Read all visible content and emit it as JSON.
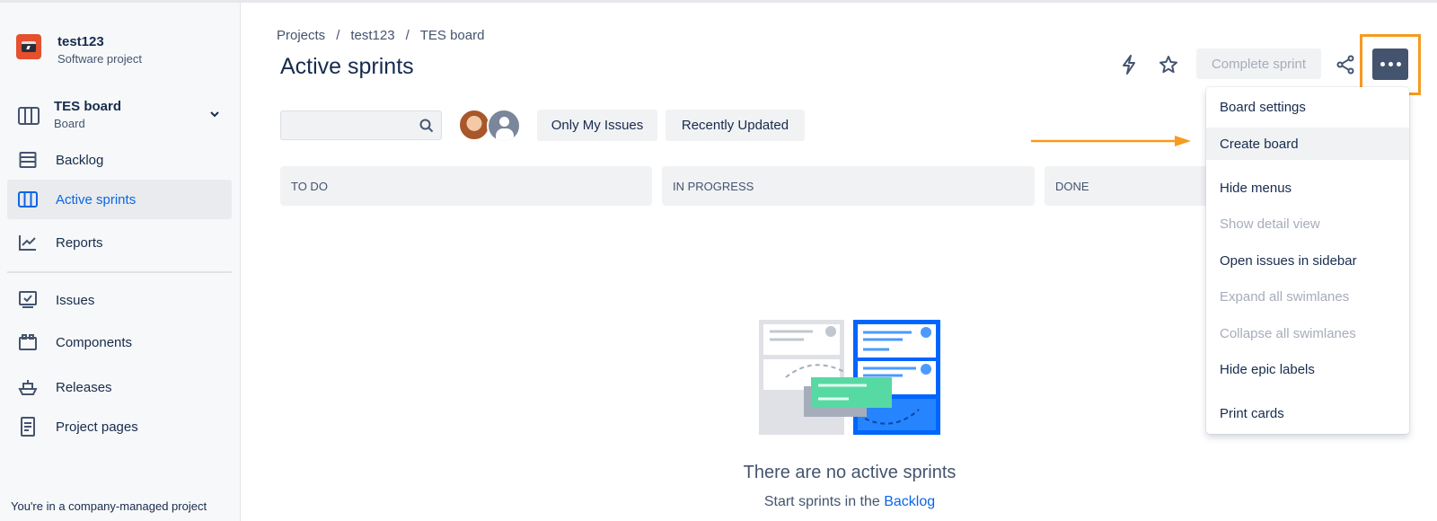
{
  "project": {
    "name": "test123",
    "type": "Software project"
  },
  "board_selector": {
    "name": "TES board",
    "subtitle": "Board"
  },
  "nav": {
    "backlog": "Backlog",
    "active_sprints": "Active sprints",
    "reports": "Reports",
    "issues": "Issues",
    "components": "Components",
    "releases": "Releases",
    "project_pages": "Project pages"
  },
  "sidebar_footer": "You're in a company-managed project",
  "breadcrumb": {
    "item1": "Projects",
    "sep": "/",
    "item2": "test123",
    "item3": "TES board"
  },
  "page_title": "Active sprints",
  "toolbar": {
    "complete_sprint": "Complete sprint"
  },
  "filters": {
    "only_my_issues": "Only My Issues",
    "recently_updated": "Recently Updated"
  },
  "columns": {
    "todo": "TO DO",
    "in_progress": "IN PROGRESS",
    "done": "DONE"
  },
  "empty_state": {
    "title": "There are no active sprints",
    "subtitle_prefix": "Start sprints in the",
    "subtitle_link": "Backlog"
  },
  "menu": {
    "board_settings": "Board settings",
    "create_board": "Create board",
    "hide_menus": "Hide menus",
    "show_detail_view": "Show detail view",
    "open_issues_in_sidebar": "Open issues in sidebar",
    "expand_all_swimlanes": "Expand all swimlanes",
    "collapse_all_swimlanes": "Collapse all swimlanes",
    "hide_epic_labels": "Hide epic labels",
    "print_cards": "Print cards"
  },
  "colors": {
    "accent": "#0c66e4",
    "highlight": "#f79a1f",
    "more_button": "#44546f"
  }
}
